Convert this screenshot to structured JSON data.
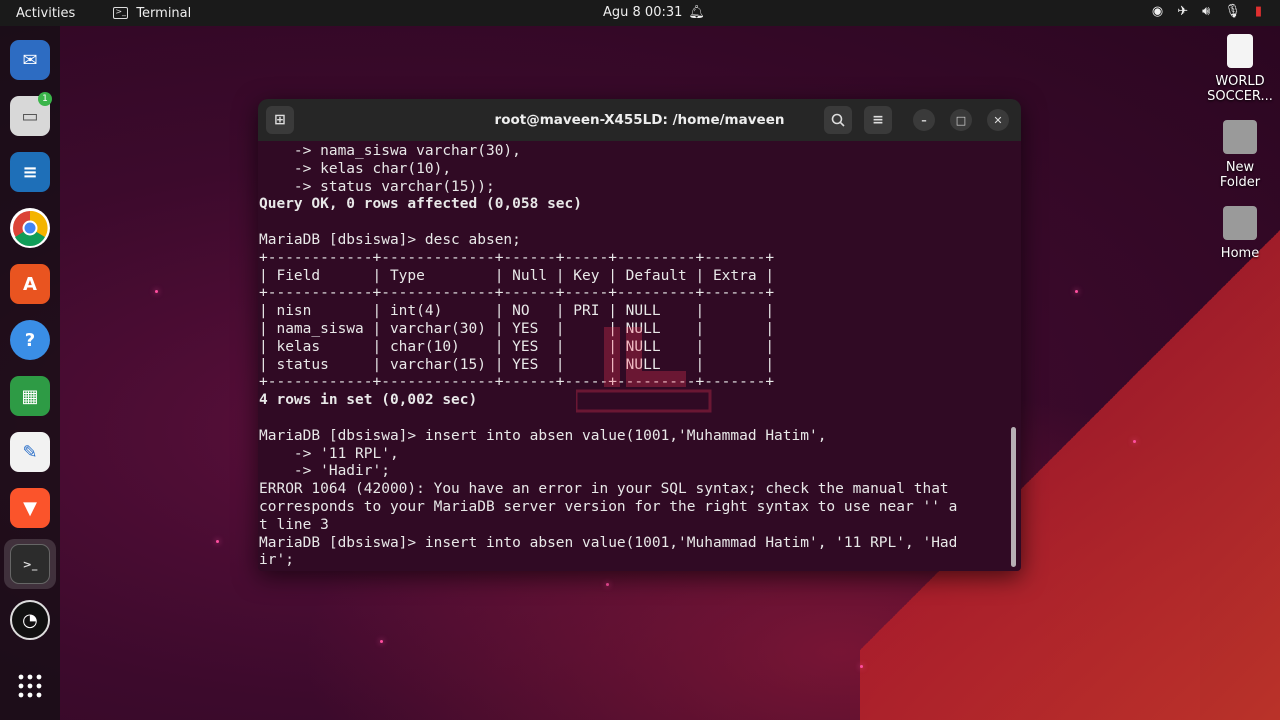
{
  "topbar": {
    "activities": "Activities",
    "app_name": "Terminal",
    "clock": "Agu 8  00:31"
  },
  "desktop": {
    "icons": [
      {
        "label": "WORLD SOCCER..."
      },
      {
        "label": "New Folder"
      },
      {
        "label": "Home"
      }
    ]
  },
  "dock": {
    "files_badge": "1"
  },
  "terminal": {
    "title": "root@maveen-X455LD: /home/maveen",
    "lines": [
      {
        "text": "    -> nama_siswa varchar(30),",
        "bold": false
      },
      {
        "text": "    -> kelas char(10),",
        "bold": false
      },
      {
        "text": "    -> status varchar(15));",
        "bold": false
      },
      {
        "text": "Query OK, 0 rows affected (0,058 sec)",
        "bold": true
      },
      {
        "text": "",
        "bold": false
      },
      {
        "text": "MariaDB [dbsiswa]> desc absen;",
        "bold": false
      },
      {
        "text": "+------------+-------------+------+-----+---------+-------+",
        "bold": false
      },
      {
        "text": "| Field      | Type        | Null | Key | Default | Extra |",
        "bold": false
      },
      {
        "text": "+------------+-------------+------+-----+---------+-------+",
        "bold": false
      },
      {
        "text": "| nisn       | int(4)      | NO   | PRI | NULL    |       |",
        "bold": false
      },
      {
        "text": "| nama_siswa | varchar(30) | YES  |     | NULL    |       |",
        "bold": false
      },
      {
        "text": "| kelas      | char(10)    | YES  |     | NULL    |       |",
        "bold": false
      },
      {
        "text": "| status     | varchar(15) | YES  |     | NULL    |       |",
        "bold": false
      },
      {
        "text": "+------------+-------------+------+-----+---------+-------+",
        "bold": false
      },
      {
        "text": "4 rows in set (0,002 sec)",
        "bold": true
      },
      {
        "text": "",
        "bold": false
      },
      {
        "text": "MariaDB [dbsiswa]> insert into absen value(1001,'Muhammad Hatim',",
        "bold": false
      },
      {
        "text": "    -> '11 RPL',",
        "bold": false
      },
      {
        "text": "    -> 'Hadir';",
        "bold": false
      },
      {
        "text": "ERROR 1064 (42000): You have an error in your SQL syntax; check the manual that",
        "bold": false
      },
      {
        "text": "corresponds to your MariaDB server version for the right syntax to use near '' a",
        "bold": false
      },
      {
        "text": "t line 3",
        "bold": false
      },
      {
        "text": "MariaDB [dbsiswa]> insert into absen value(1001,'Muhammad Hatim', '11 RPL', 'Had",
        "bold": false
      },
      {
        "text": "ir';",
        "bold": false
      }
    ]
  },
  "colors": {
    "terminal_bg": "#300a24",
    "headerbar_bg": "#262626",
    "accent": "#e95420"
  }
}
